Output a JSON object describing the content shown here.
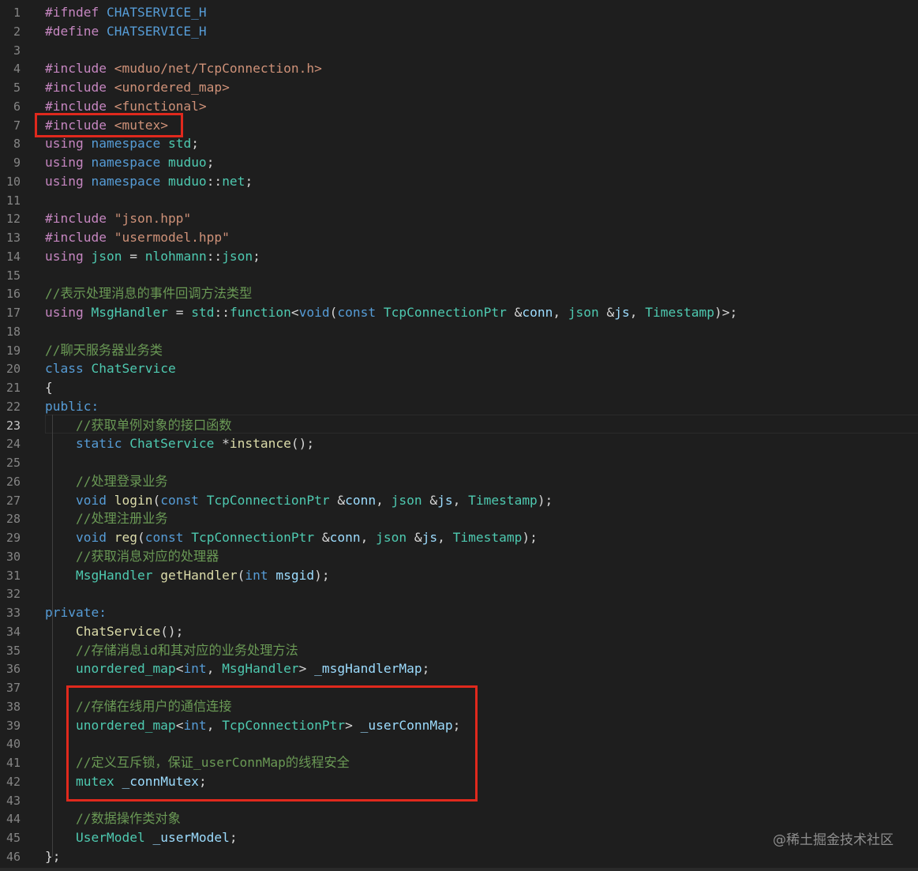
{
  "editor": {
    "active_line": 23,
    "watermark": "@稀土掘金技术社区",
    "lines": [
      {
        "n": "1",
        "tokens": [
          [
            "#ifndef ",
            "#c586c0"
          ],
          [
            "CHATSERVICE_H",
            "#569cd6"
          ]
        ]
      },
      {
        "n": "2",
        "tokens": [
          [
            "#define ",
            "#c586c0"
          ],
          [
            "CHATSERVICE_H",
            "#569cd6"
          ]
        ]
      },
      {
        "n": "3",
        "tokens": []
      },
      {
        "n": "4",
        "tokens": [
          [
            "#include ",
            "#c586c0"
          ],
          [
            "<muduo/net/TcpConnection.h>",
            "#ce9178"
          ]
        ]
      },
      {
        "n": "5",
        "tokens": [
          [
            "#include ",
            "#c586c0"
          ],
          [
            "<unordered_map>",
            "#ce9178"
          ]
        ]
      },
      {
        "n": "6",
        "tokens": [
          [
            "#include ",
            "#c586c0"
          ],
          [
            "<functional>",
            "#ce9178"
          ]
        ]
      },
      {
        "n": "7",
        "tokens": [
          [
            "#include ",
            "#c586c0"
          ],
          [
            "<mutex>",
            "#ce9178"
          ]
        ]
      },
      {
        "n": "8",
        "tokens": [
          [
            "using ",
            "#c586c0"
          ],
          [
            "namespace ",
            "#569cd6"
          ],
          [
            "std",
            "#4ec9b0"
          ],
          [
            ";",
            "#d4d4d4"
          ]
        ]
      },
      {
        "n": "9",
        "tokens": [
          [
            "using ",
            "#c586c0"
          ],
          [
            "namespace ",
            "#569cd6"
          ],
          [
            "muduo",
            "#4ec9b0"
          ],
          [
            ";",
            "#d4d4d4"
          ]
        ]
      },
      {
        "n": "10",
        "tokens": [
          [
            "using ",
            "#c586c0"
          ],
          [
            "namespace ",
            "#569cd6"
          ],
          [
            "muduo",
            "#4ec9b0"
          ],
          [
            "::",
            "#d4d4d4"
          ],
          [
            "net",
            "#4ec9b0"
          ],
          [
            ";",
            "#d4d4d4"
          ]
        ]
      },
      {
        "n": "11",
        "tokens": []
      },
      {
        "n": "12",
        "tokens": [
          [
            "#include ",
            "#c586c0"
          ],
          [
            "\"json.hpp\"",
            "#ce9178"
          ]
        ]
      },
      {
        "n": "13",
        "tokens": [
          [
            "#include ",
            "#c586c0"
          ],
          [
            "\"usermodel.hpp\"",
            "#ce9178"
          ]
        ]
      },
      {
        "n": "14",
        "tokens": [
          [
            "using ",
            "#c586c0"
          ],
          [
            "json",
            "#4ec9b0"
          ],
          [
            " = ",
            "#d4d4d4"
          ],
          [
            "nlohmann",
            "#4ec9b0"
          ],
          [
            "::",
            "#d4d4d4"
          ],
          [
            "json",
            "#4ec9b0"
          ],
          [
            ";",
            "#d4d4d4"
          ]
        ]
      },
      {
        "n": "15",
        "tokens": []
      },
      {
        "n": "16",
        "tokens": [
          [
            "//表示处理消息的事件回调方法类型",
            "#6a9955"
          ]
        ]
      },
      {
        "n": "17",
        "tokens": [
          [
            "using ",
            "#c586c0"
          ],
          [
            "MsgHandler",
            "#4ec9b0"
          ],
          [
            " = ",
            "#d4d4d4"
          ],
          [
            "std",
            "#4ec9b0"
          ],
          [
            "::",
            "#d4d4d4"
          ],
          [
            "function",
            "#4ec9b0"
          ],
          [
            "<",
            "#d4d4d4"
          ],
          [
            "void",
            "#569cd6"
          ],
          [
            "(",
            "#d4d4d4"
          ],
          [
            "const ",
            "#569cd6"
          ],
          [
            "TcpConnectionPtr",
            "#4ec9b0"
          ],
          [
            " &",
            "#d4d4d4"
          ],
          [
            "conn",
            "#9cdcfe"
          ],
          [
            ", ",
            "#d4d4d4"
          ],
          [
            "json",
            "#4ec9b0"
          ],
          [
            " &",
            "#d4d4d4"
          ],
          [
            "js",
            "#9cdcfe"
          ],
          [
            ", ",
            "#d4d4d4"
          ],
          [
            "Timestamp",
            "#4ec9b0"
          ],
          [
            ")>;",
            "#d4d4d4"
          ]
        ]
      },
      {
        "n": "18",
        "tokens": []
      },
      {
        "n": "19",
        "tokens": [
          [
            "//聊天服务器业务类",
            "#6a9955"
          ]
        ]
      },
      {
        "n": "20",
        "tokens": [
          [
            "class ",
            "#569cd6"
          ],
          [
            "ChatService",
            "#4ec9b0"
          ]
        ]
      },
      {
        "n": "21",
        "tokens": [
          [
            "{",
            "#d4d4d4"
          ]
        ]
      },
      {
        "n": "22",
        "tokens": [
          [
            "public:",
            "#569cd6"
          ]
        ]
      },
      {
        "n": "23",
        "tokens": [
          [
            "    //获取单例对象的接口函数",
            "#6a9955"
          ]
        ]
      },
      {
        "n": "24",
        "tokens": [
          [
            "    static ",
            "#569cd6"
          ],
          [
            "ChatService",
            "#4ec9b0"
          ],
          [
            " *",
            "#d4d4d4"
          ],
          [
            "instance",
            "#dcdcaa"
          ],
          [
            "();",
            "#d4d4d4"
          ]
        ]
      },
      {
        "n": "25",
        "tokens": []
      },
      {
        "n": "26",
        "tokens": [
          [
            "    //处理登录业务",
            "#6a9955"
          ]
        ]
      },
      {
        "n": "27",
        "tokens": [
          [
            "    void ",
            "#569cd6"
          ],
          [
            "login",
            "#dcdcaa"
          ],
          [
            "(",
            "#d4d4d4"
          ],
          [
            "const ",
            "#569cd6"
          ],
          [
            "TcpConnectionPtr",
            "#4ec9b0"
          ],
          [
            " &",
            "#d4d4d4"
          ],
          [
            "conn",
            "#9cdcfe"
          ],
          [
            ", ",
            "#d4d4d4"
          ],
          [
            "json",
            "#4ec9b0"
          ],
          [
            " &",
            "#d4d4d4"
          ],
          [
            "js",
            "#9cdcfe"
          ],
          [
            ", ",
            "#d4d4d4"
          ],
          [
            "Timestamp",
            "#4ec9b0"
          ],
          [
            ");",
            "#d4d4d4"
          ]
        ]
      },
      {
        "n": "28",
        "tokens": [
          [
            "    //处理注册业务",
            "#6a9955"
          ]
        ]
      },
      {
        "n": "29",
        "tokens": [
          [
            "    void ",
            "#569cd6"
          ],
          [
            "reg",
            "#dcdcaa"
          ],
          [
            "(",
            "#d4d4d4"
          ],
          [
            "const ",
            "#569cd6"
          ],
          [
            "TcpConnectionPtr",
            "#4ec9b0"
          ],
          [
            " &",
            "#d4d4d4"
          ],
          [
            "conn",
            "#9cdcfe"
          ],
          [
            ", ",
            "#d4d4d4"
          ],
          [
            "json",
            "#4ec9b0"
          ],
          [
            " &",
            "#d4d4d4"
          ],
          [
            "js",
            "#9cdcfe"
          ],
          [
            ", ",
            "#d4d4d4"
          ],
          [
            "Timestamp",
            "#4ec9b0"
          ],
          [
            ");",
            "#d4d4d4"
          ]
        ]
      },
      {
        "n": "30",
        "tokens": [
          [
            "    //获取消息对应的处理器",
            "#6a9955"
          ]
        ]
      },
      {
        "n": "31",
        "tokens": [
          [
            "    MsgHandler",
            "#4ec9b0"
          ],
          [
            " ",
            "#d4d4d4"
          ],
          [
            "getHandler",
            "#dcdcaa"
          ],
          [
            "(",
            "#d4d4d4"
          ],
          [
            "int ",
            "#569cd6"
          ],
          [
            "msgid",
            "#9cdcfe"
          ],
          [
            ");",
            "#d4d4d4"
          ]
        ]
      },
      {
        "n": "32",
        "tokens": []
      },
      {
        "n": "33",
        "tokens": [
          [
            "private:",
            "#569cd6"
          ]
        ]
      },
      {
        "n": "34",
        "tokens": [
          [
            "    ChatService",
            "#dcdcaa"
          ],
          [
            "();",
            "#d4d4d4"
          ]
        ]
      },
      {
        "n": "35",
        "tokens": [
          [
            "    //存储消息id和其对应的业务处理方法",
            "#6a9955"
          ]
        ]
      },
      {
        "n": "36",
        "tokens": [
          [
            "    unordered_map",
            "#4ec9b0"
          ],
          [
            "<",
            "#d4d4d4"
          ],
          [
            "int",
            "#569cd6"
          ],
          [
            ", ",
            "#d4d4d4"
          ],
          [
            "MsgHandler",
            "#4ec9b0"
          ],
          [
            "> ",
            "#d4d4d4"
          ],
          [
            "_msgHandlerMap",
            "#9cdcfe"
          ],
          [
            ";",
            "#d4d4d4"
          ]
        ]
      },
      {
        "n": "37",
        "tokens": []
      },
      {
        "n": "38",
        "tokens": [
          [
            "    //存储在线用户的通信连接",
            "#6a9955"
          ]
        ]
      },
      {
        "n": "39",
        "tokens": [
          [
            "    unordered_map",
            "#4ec9b0"
          ],
          [
            "<",
            "#d4d4d4"
          ],
          [
            "int",
            "#569cd6"
          ],
          [
            ", ",
            "#d4d4d4"
          ],
          [
            "TcpConnectionPtr",
            "#4ec9b0"
          ],
          [
            "> ",
            "#d4d4d4"
          ],
          [
            "_userConnMap",
            "#9cdcfe"
          ],
          [
            ";",
            "#d4d4d4"
          ]
        ]
      },
      {
        "n": "40",
        "tokens": []
      },
      {
        "n": "41",
        "tokens": [
          [
            "    //定义互斥锁，保证_userConnMap的线程安全",
            "#6a9955"
          ]
        ]
      },
      {
        "n": "42",
        "tokens": [
          [
            "    mutex",
            "#4ec9b0"
          ],
          [
            " ",
            "#d4d4d4"
          ],
          [
            "_connMutex",
            "#9cdcfe"
          ],
          [
            ";",
            "#d4d4d4"
          ]
        ]
      },
      {
        "n": "43",
        "tokens": []
      },
      {
        "n": "44",
        "tokens": [
          [
            "    //数据操作类对象",
            "#6a9955"
          ]
        ]
      },
      {
        "n": "45",
        "tokens": [
          [
            "    UserModel",
            "#4ec9b0"
          ],
          [
            " ",
            "#d4d4d4"
          ],
          [
            "_userModel",
            "#9cdcfe"
          ],
          [
            ";",
            "#d4d4d4"
          ]
        ]
      },
      {
        "n": "46",
        "tokens": [
          [
            "};",
            "#d4d4d4"
          ]
        ]
      }
    ]
  }
}
